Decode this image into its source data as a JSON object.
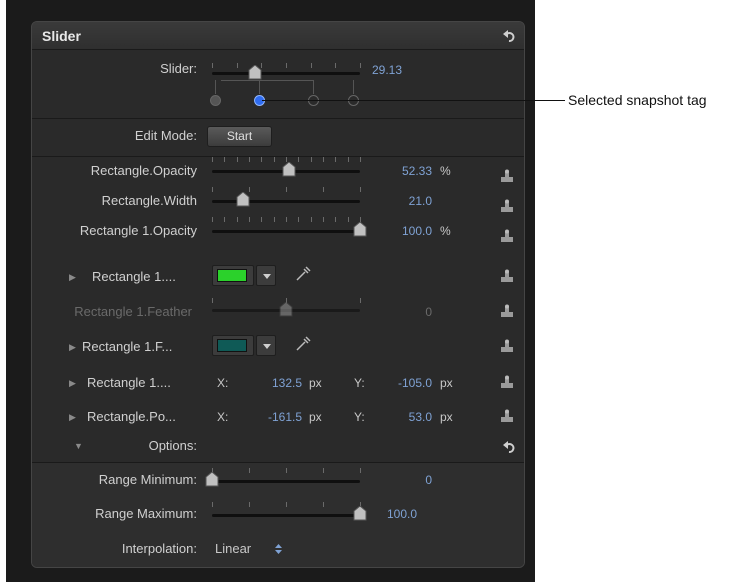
{
  "panel": {
    "title": "Slider",
    "slider": {
      "label": "Slider:",
      "value": "29.13",
      "fraction": 0.29,
      "snapshot_tags": [
        {
          "selected": false
        },
        {
          "selected": true
        },
        {
          "selected": false
        },
        {
          "selected": false
        }
      ]
    },
    "edit_mode": {
      "label": "Edit Mode:",
      "button": "Start"
    },
    "params": [
      {
        "label": "Rectangle.Opacity",
        "value": "52.33",
        "unit": "%",
        "fraction": 0.52
      },
      {
        "label": "Rectangle.Width",
        "value": "21.0",
        "unit": "",
        "fraction": 0.21
      },
      {
        "label": "Rectangle 1.Opacity",
        "value": "100.0",
        "unit": "%",
        "fraction": 1.0
      }
    ],
    "color_row_1": {
      "label": "Rectangle 1....",
      "color": "#2bd12b"
    },
    "feather": {
      "label": "Rectangle 1.Feather",
      "value": "0",
      "fraction": 0.5
    },
    "color_row_2": {
      "label": "Rectangle 1.F...",
      "color": "#0f5a56"
    },
    "pos_rows": [
      {
        "label": "Rectangle 1....",
        "x_label": "X:",
        "x": "132.5",
        "x_unit": "px",
        "y_label": "Y:",
        "y": "-105.0",
        "y_unit": "px"
      },
      {
        "label": "Rectangle.Po...",
        "x_label": "X:",
        "x": "-161.5",
        "x_unit": "px",
        "y_label": "Y:",
        "y": "53.0",
        "y_unit": "px"
      }
    ],
    "options": {
      "label": "Options:",
      "range_min": {
        "label": "Range Minimum:",
        "value": "0",
        "fraction": 0.0
      },
      "range_max": {
        "label": "Range Maximum:",
        "value": "100.0",
        "fraction": 1.0
      },
      "interpolation": {
        "label": "Interpolation:",
        "value": "Linear"
      }
    }
  },
  "callout": "Selected snapshot tag",
  "colors": {
    "accent_value": "#7fa2d4",
    "selected_tag": "#2f6cf0"
  }
}
